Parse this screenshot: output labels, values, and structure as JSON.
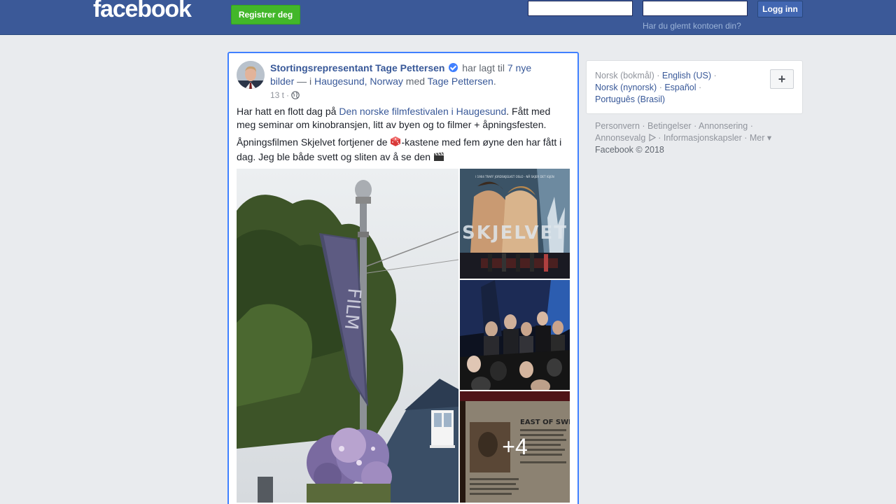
{
  "header": {
    "logo": "facebook",
    "register_label": "Registrer deg",
    "email_value": "",
    "password_value": "",
    "login_label": "Logg inn",
    "forgot_label": "Har du glemt kontoen din?"
  },
  "post": {
    "author": "Stortingsrepresentant Tage Pettersen",
    "action_text": "har lagt til",
    "photos_link": "7 nye bilder",
    "location_prefix": "— i",
    "location_link": "Haugesund, Norway",
    "with_text": "med",
    "tagged_person": "Tage Pettersen",
    "tagged_suffix": ".",
    "time": "13 t",
    "time_sep": "·",
    "paragraph1_prefix": "Har hatt en flott dag på ",
    "paragraph1_link": "Den norske filmfestivalen i Haugesund",
    "paragraph1_suffix": ". Fått med meg seminar om kinobransjen, litt av byen og to filmer + åpningsfesten.",
    "paragraph2_prefix": "Åpningsfilmen Skjelvet fortjener de ",
    "paragraph2_middle": "-kastene med fem øyne den har fått i dag. Jeg ble både svett og sliten av å se den ",
    "more_photos_label": "+4",
    "poster_tagline": "I 1904 TRAFF JORDSKJELVET OSLO - NÅ SKJER DET IGJEN",
    "poster_title": "SKJELVET",
    "banner_text": "FILM",
    "sign_title": "EAST OF SWEDE"
  },
  "sidebar": {
    "languages": [
      {
        "label": "Norsk (bokmål)",
        "current": true
      },
      {
        "label": "English (US)",
        "current": false
      },
      {
        "label": "Norsk (nynorsk)",
        "current": false
      },
      {
        "label": "Español",
        "current": false
      },
      {
        "label": "Português (Brasil)",
        "current": false
      }
    ],
    "add_language_label": "+",
    "footer_links": [
      "Personvern",
      "Betingelser",
      "Annonsering",
      "Annonsevalg",
      "Informasjonskapsler",
      "Mer"
    ],
    "copyright": "Facebook © 2018"
  },
  "colors": {
    "brand_blue": "#3b5998",
    "link_blue": "#385898",
    "register_green": "#42b72a",
    "focus_border": "#4080ff"
  }
}
